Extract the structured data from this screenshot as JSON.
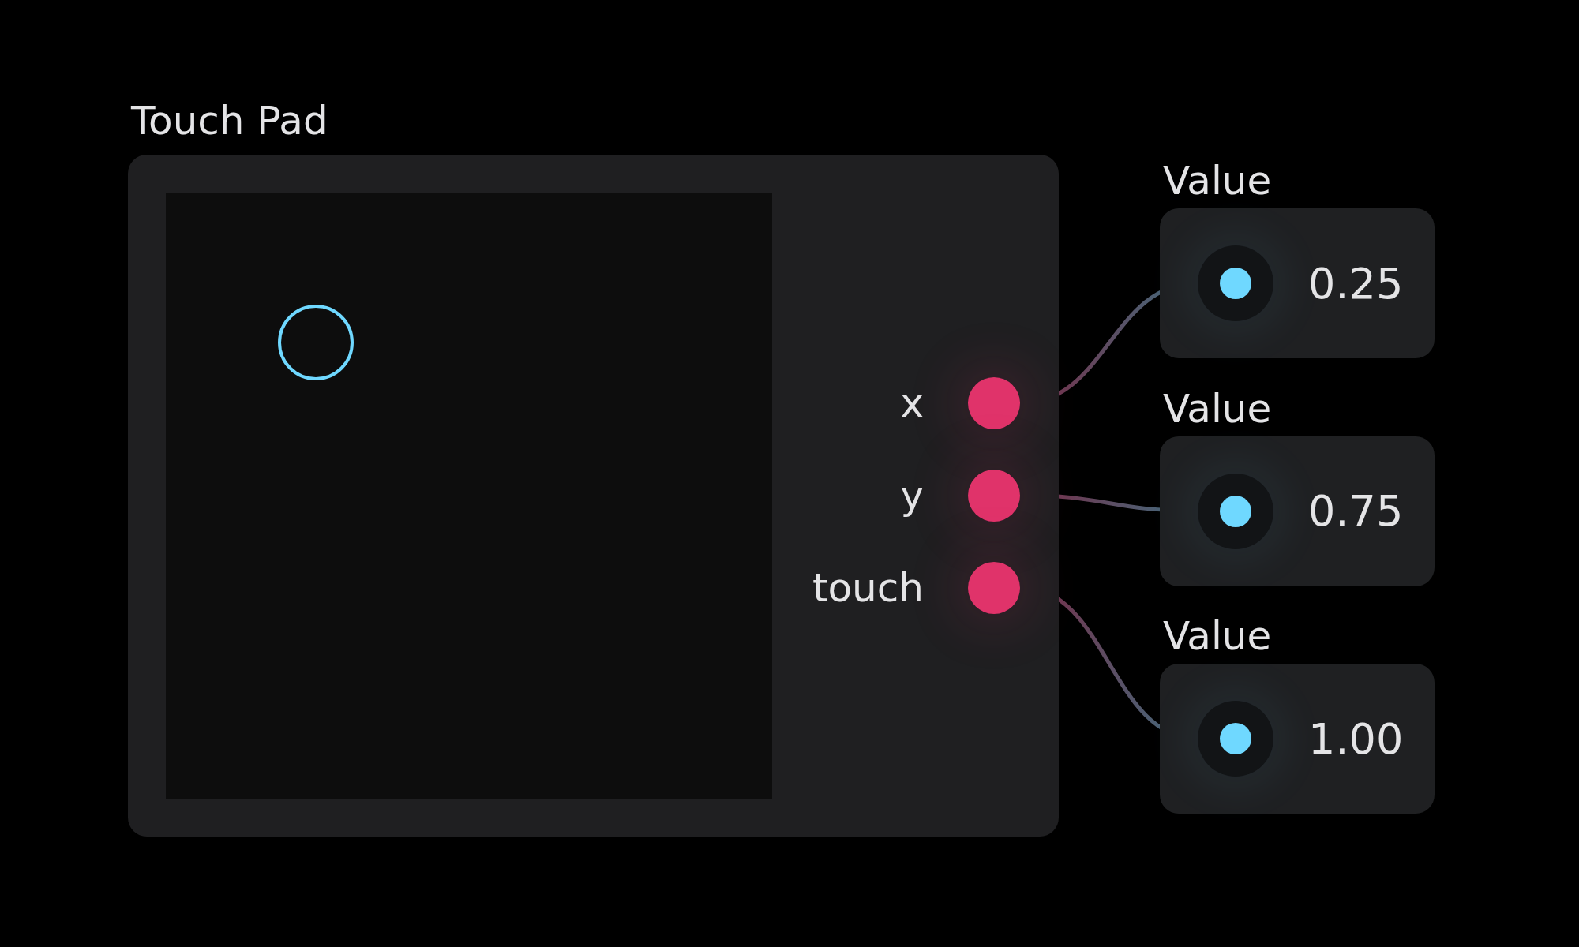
{
  "touch_pad": {
    "title": "Touch Pad",
    "outputs": [
      {
        "label": "x"
      },
      {
        "label": "y"
      },
      {
        "label": "touch"
      }
    ]
  },
  "value_nodes": [
    {
      "title": "Value",
      "value": "0.25"
    },
    {
      "title": "Value",
      "value": "0.75"
    },
    {
      "title": "Value",
      "value": "1.00"
    }
  ]
}
